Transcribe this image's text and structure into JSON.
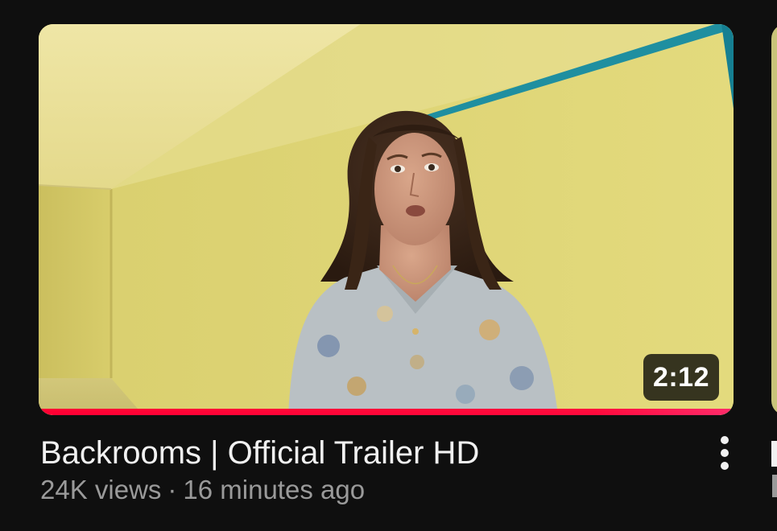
{
  "video": {
    "title": "Backrooms | Official Trailer HD",
    "views": "24K views",
    "separator": "·",
    "age": "16 minutes ago",
    "duration": "2:12",
    "watch_progress": 1.0,
    "progress_color": "#ff0033"
  },
  "icons": {
    "more": "more-vert-icon"
  },
  "colors": {
    "background": "#0f0f0f",
    "title_text": "#f1f1f1",
    "meta_text": "#9a9a9a"
  }
}
